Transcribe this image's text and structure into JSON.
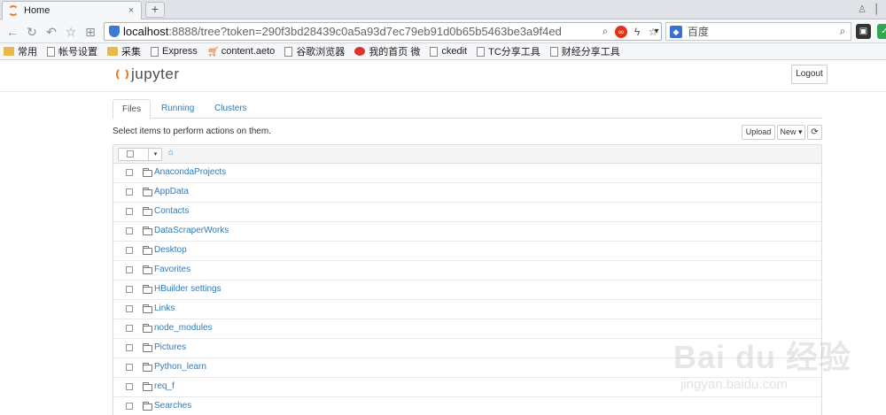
{
  "browser": {
    "tab_title": "Home",
    "tab_close": "×",
    "new_tab": "+",
    "url_host": "localhost",
    "url_rest": ":8888/tree?token=290f3bd28439c0a5a93d7ec79eb91d0b65b5463be3a9f4ed",
    "search_placeholder": "百度",
    "search_engine_icon": "baidu-paw",
    "search_engine_glyph": "◆"
  },
  "bookmarks": [
    {
      "label": "常用",
      "icon": "folder"
    },
    {
      "label": "帐号设置",
      "icon": "page"
    },
    {
      "label": "采集",
      "icon": "folder"
    },
    {
      "label": "Express",
      "icon": "page"
    },
    {
      "label": "content.aeto",
      "icon": "cart"
    },
    {
      "label": "谷歌浏览器",
      "icon": "page"
    },
    {
      "label": "我的首页 微",
      "icon": "weibo"
    },
    {
      "label": "ckedit",
      "icon": "page"
    },
    {
      "label": "TC分享工具",
      "icon": "page"
    },
    {
      "label": "财经分享工具",
      "icon": "page"
    }
  ],
  "jupyter": {
    "logo_text": "jupyter",
    "logout_label": "Logout",
    "tabs": [
      "Files",
      "Running",
      "Clusters"
    ],
    "hint": "Select items to perform actions on them.",
    "upload_label": "Upload",
    "new_label": "New ▾",
    "refresh_glyph": "⟳",
    "home_glyph": "⌂",
    "caret_glyph": "▾",
    "files": [
      "AnacondaProjects",
      "AppData",
      "Contacts",
      "DataScraperWorks",
      "Desktop",
      "Favorites",
      "HBuilder settings",
      "Links",
      "node_modules",
      "Pictures",
      "Python_learn",
      "req_f",
      "Searches"
    ]
  },
  "watermark": {
    "main": "Bai du 经验",
    "sub": "jingyan.baidu.com"
  },
  "colors": {
    "jupyter_orange": "#f37726",
    "link_blue": "#337ab7"
  }
}
